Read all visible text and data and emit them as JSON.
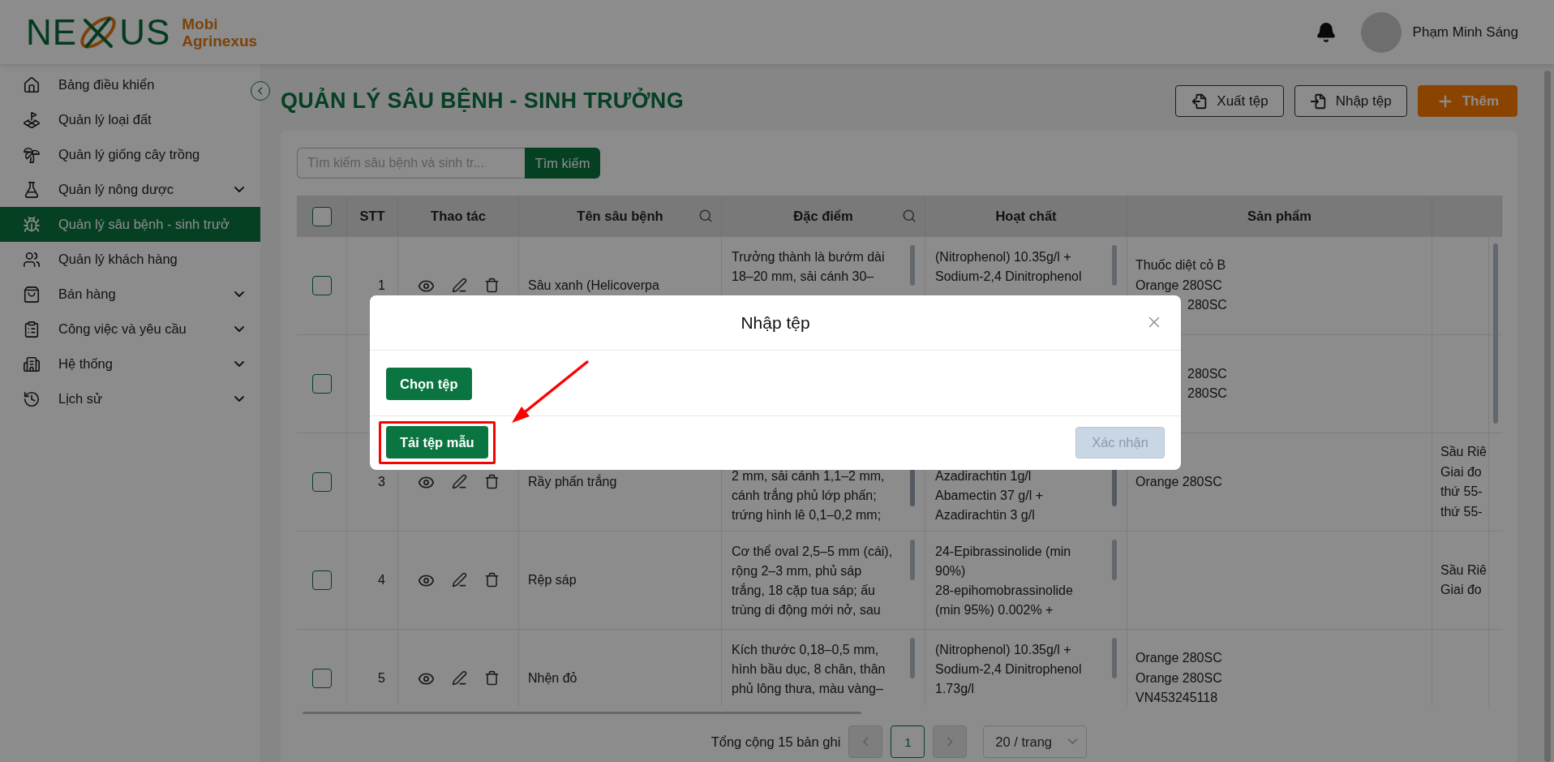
{
  "logo": {
    "letters_left": "NE",
    "letters_right": "US",
    "line1": "Mobi",
    "line2": "Agrinexus"
  },
  "header": {
    "user_name": "Phạm Minh Sáng"
  },
  "sidebar": {
    "items": [
      {
        "label": "Bảng điều khiển",
        "selected": false,
        "has_submenu": false
      },
      {
        "label": "Quản lý loại đất",
        "selected": false,
        "has_submenu": false
      },
      {
        "label": "Quản lý giống cây trồng",
        "selected": false,
        "has_submenu": false
      },
      {
        "label": "Quản lý nông dược",
        "selected": false,
        "has_submenu": true
      },
      {
        "label": "Quản lý sâu bệnh - sinh trưở",
        "selected": true,
        "has_submenu": false
      },
      {
        "label": "Quản lý khách hàng",
        "selected": false,
        "has_submenu": false
      },
      {
        "label": "Bán hàng",
        "selected": false,
        "has_submenu": true
      },
      {
        "label": "Công việc và yêu cầu",
        "selected": false,
        "has_submenu": true
      },
      {
        "label": "Hệ thống",
        "selected": false,
        "has_submenu": true
      },
      {
        "label": "Lịch sử",
        "selected": false,
        "has_submenu": true
      }
    ]
  },
  "page": {
    "title": "QUẢN LÝ SÂU BỆNH - SINH TRƯỞNG",
    "actions": [
      {
        "label": "Xuất tệp",
        "kind": "export"
      },
      {
        "label": "Nhập tệp",
        "kind": "import"
      },
      {
        "label": "Thêm",
        "kind": "add"
      }
    ]
  },
  "search": {
    "placeholder": "Tìm kiếm sâu bệnh và sinh tr...",
    "button": "Tìm kiếm"
  },
  "table": {
    "select_all_checked": false,
    "columns": [
      {
        "label": "STT",
        "searchable": false
      },
      {
        "label": "Thao tác",
        "searchable": false
      },
      {
        "label": "Tên sâu bệnh",
        "searchable": true
      },
      {
        "label": "Đặc điểm",
        "searchable": true
      },
      {
        "label": "Hoạt chất",
        "searchable": false
      },
      {
        "label": "Sản phẩm",
        "searchable": false
      }
    ],
    "rows": [
      {
        "checked": false,
        "number": "1",
        "name": "Sâu xanh (Helicoverpa",
        "features": [
          "Trưởng thành là bướm dài",
          "18–20 mm, sải cánh 30–"
        ],
        "ingredients": [
          "(Nitrophenol) 10.35g/l +",
          "Sodium-2,4 Dinitrophenol"
        ],
        "products": [
          {
            "text": "Thuốc diệt cỏ B",
            "cut_by_dialog": false
          },
          {
            "text": "Orange 280SC",
            "cut_by_dialog": false
          },
          {
            "text": "280SC",
            "cut_by_dialog": true
          }
        ],
        "scrolled": false
      },
      {
        "checked": false,
        "products": [
          {
            "text": "280SC",
            "cut_by_dialog": true
          },
          {
            "text": "280SC",
            "cut_by_dialog": true
          }
        ]
      },
      {
        "checked": false,
        "number": "3",
        "name": "Rầy phấn trắng",
        "features": [
          "2 mm, sải cánh 1,1–2 mm,",
          "cánh trắng phủ lớp phấn;",
          "trứng hình lê 0,1–0,2 mm;"
        ],
        "ingredients": [
          "Azadirachtin 1g/l",
          "Abamectin 37 g/l +",
          "Azadirachtin 3 g/l"
        ],
        "products": [
          {
            "text": "Orange 280SC",
            "cut_by_dialog": false
          }
        ],
        "column_8": [
          "Sầu Riê",
          "Giai đo",
          "thứ 55-",
          "thứ 55-"
        ],
        "scrolled": true
      },
      {
        "checked": false,
        "number": "4",
        "name": "Rệp sáp",
        "features": [
          "Cơ thể oval 2,5–5 mm (cái),",
          "rộng 2–3 mm, phủ sáp",
          "trắng, 18 cặp tua sáp; ấu",
          "trùng di động mới nở, sau"
        ],
        "ingredients": [
          "24-Epibrassinolide (min",
          "90%)",
          "28-epihomobrassinolide",
          "(min 95%) 0.002% +"
        ],
        "column_8": [
          "Sầu Riê",
          "Giai đo"
        ],
        "scrolled": false
      },
      {
        "checked": false,
        "number": "5",
        "name": "Nhện đỏ",
        "features": [
          "Kích thước 0,18–0,5 mm,",
          "hình bầu dục, 8 chân, thân",
          "phủ lông thưa, màu vàng–"
        ],
        "ingredients": [
          "(Nitrophenol) 10.35g/l +",
          "Sodium-2,4 Dinitrophenol",
          "1.73g/l"
        ],
        "products": [
          {
            "text": "Orange 280SC",
            "cut_by_dialog": false
          },
          {
            "text": "Orange 280SC",
            "cut_by_dialog": false
          },
          {
            "text": "VN453245118",
            "cut_by_dialog": false
          }
        ],
        "scrolled": false
      }
    ]
  },
  "pagination": {
    "total": "Tổng cộng 15 bản ghi",
    "prev_disabled": true,
    "next_disabled": true,
    "pages": [
      {
        "label": "1",
        "selected": true
      }
    ],
    "page_size": "20 / trang"
  },
  "dialog": {
    "title": "Nhập tệp",
    "choose_button": "Chọn tệp",
    "template_button": "Tải tệp mẫu",
    "template_highlighted": true,
    "confirm_button": "Xác nhận",
    "confirm_disabled": true
  }
}
